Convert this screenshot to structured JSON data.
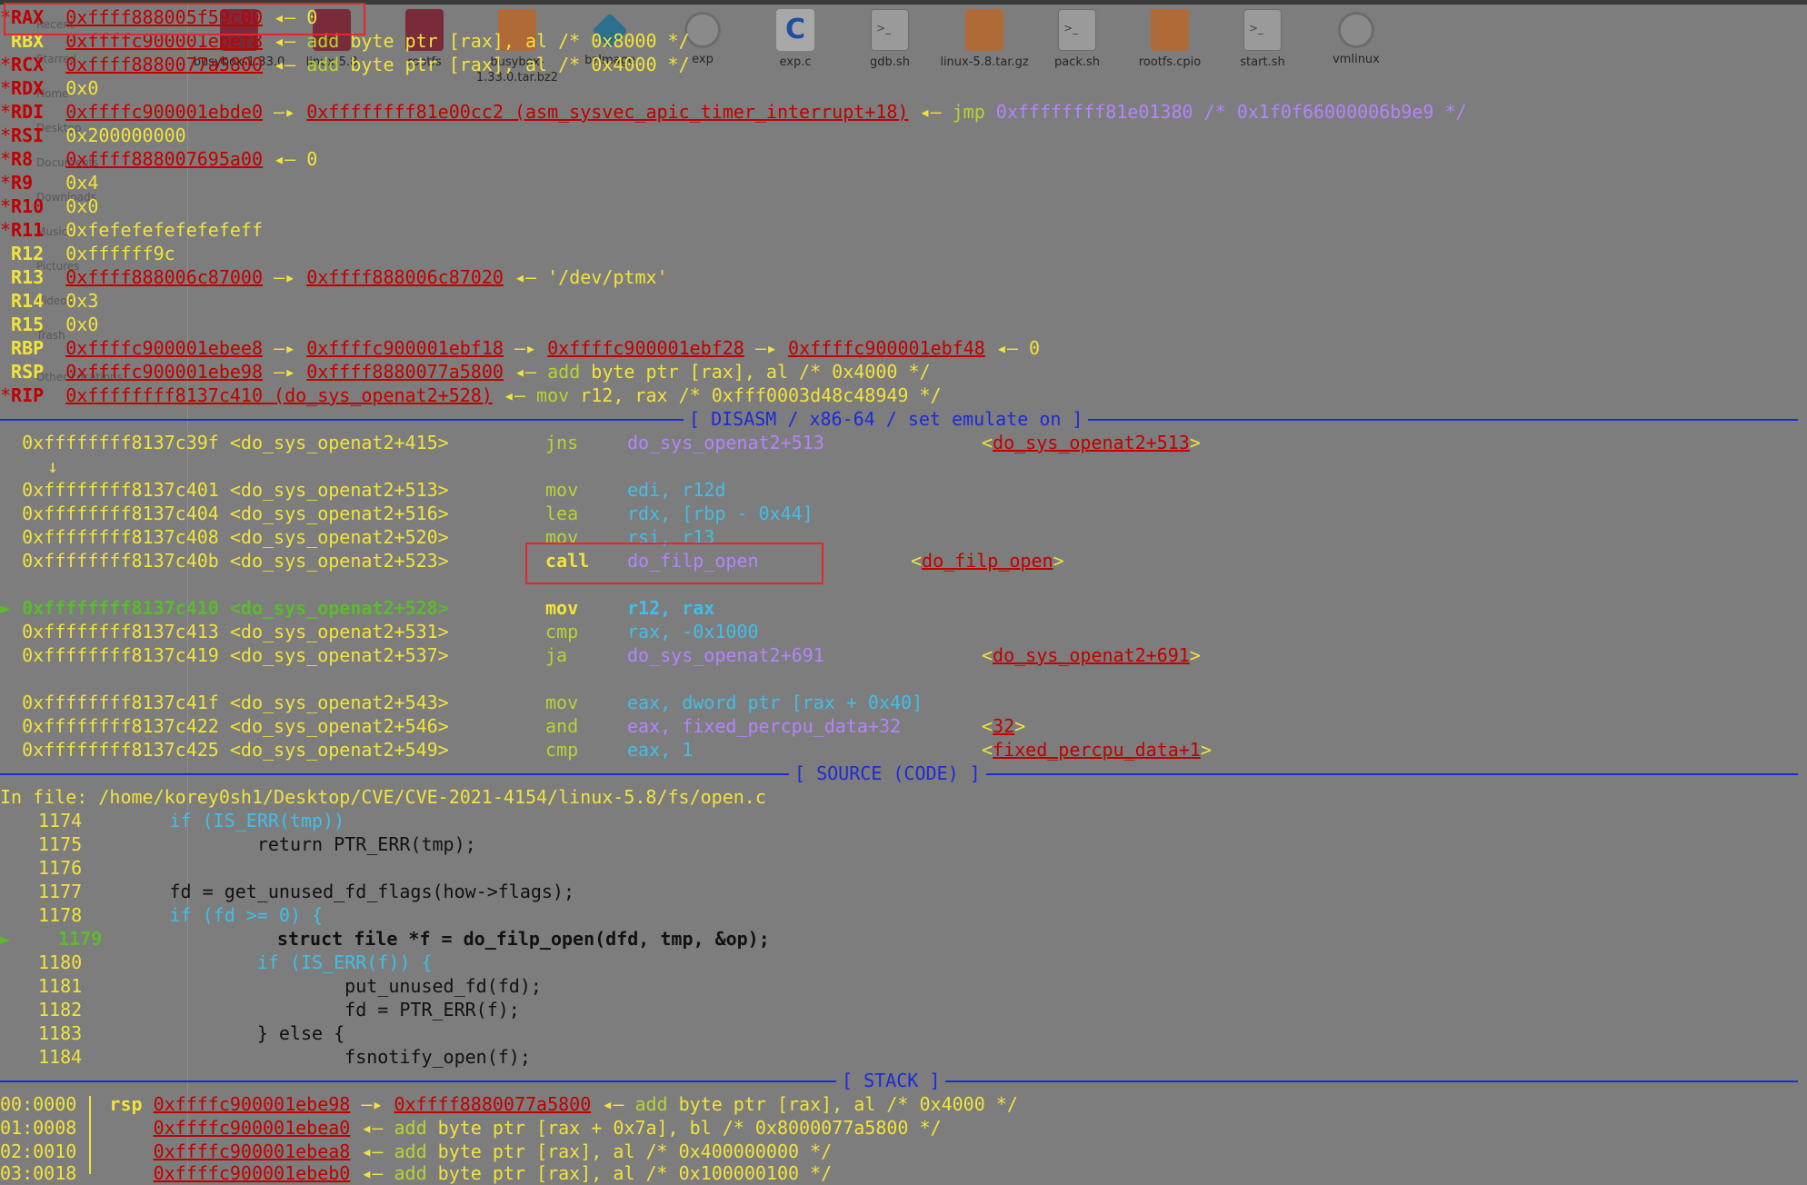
{
  "desktop": {
    "sidebar": [
      "Recent",
      "Starred",
      "Home",
      "Desktop",
      "Documents",
      "Downloads",
      "Music",
      "Pictures",
      "Videos",
      "Trash",
      "Other Locations"
    ],
    "icons": [
      {
        "label": "busybox-1.33.0",
        "kind": "folder"
      },
      {
        "label": "linux-5.8",
        "kind": "folder"
      },
      {
        "label": "rootfs",
        "kind": "folder"
      },
      {
        "label": "busybox-1.33.0.tar.bz2",
        "kind": "archive"
      },
      {
        "label": "bzImage",
        "kind": "diamond"
      },
      {
        "label": "exp",
        "kind": "gear"
      },
      {
        "label": "exp.c",
        "kind": "cfile"
      },
      {
        "label": "gdb.sh",
        "kind": "script"
      },
      {
        "label": "linux-5.8.tar.gz",
        "kind": "archive"
      },
      {
        "label": "pack.sh",
        "kind": "script"
      },
      {
        "label": "rootfs.cpio",
        "kind": "archive"
      },
      {
        "label": "start.sh",
        "kind": "script"
      },
      {
        "label": "vmlinux",
        "kind": "gear"
      }
    ]
  },
  "registers": {
    "rax": {
      "star": "*",
      "name": "RAX",
      "val": "0xffff888005f59c00",
      "arrow": " ◂— ",
      "rest": "0"
    },
    "rbx": {
      "star": " ",
      "name": "RBX",
      "val": "0xffffc900001ebef8",
      "arrow": " ◂— ",
      "ins": "add",
      "rest": " byte ptr [rax], al /* 0x8000 */"
    },
    "rcx": {
      "star": "*",
      "name": "RCX",
      "val": "0xffff8880077a5800",
      "arrow": " ◂— ",
      "ins": "add",
      "rest": " byte ptr [rax], al /* 0x4000 */"
    },
    "rdx": {
      "star": "*",
      "name": "RDX",
      "val": "0x0"
    },
    "rdi": {
      "star": "*",
      "name": "RDI",
      "val": "0xffffc900001ebde0",
      "arrow": " —▸ ",
      "val2": "0xffffffff81e00cc2 (asm_sysvec_apic_timer_interrupt+18)",
      "arrow2": " ◂— ",
      "ins": "jmp",
      "rest": " 0xffffffff81e01380 /* 0x1f0f66000006b9e9 */"
    },
    "rsi": {
      "star": "*",
      "name": "RSI",
      "val": "0x200000000"
    },
    "r8": {
      "star": "*",
      "name": "R8 ",
      "val": "0xffff888007695a00",
      "arrow": " ◂— ",
      "rest": "0"
    },
    "r9": {
      "star": "*",
      "name": "R9 ",
      "val": "0x4"
    },
    "r10": {
      "star": "*",
      "name": "R10",
      "val": "0x0"
    },
    "r11": {
      "star": "*",
      "name": "R11",
      "val": "0xfefefefefefefeff"
    },
    "r12": {
      "star": " ",
      "name": "R12",
      "val": "0xffffff9c"
    },
    "r13": {
      "star": " ",
      "name": "R13",
      "val": "0xffff888006c87000",
      "arrow": " —▸ ",
      "val2": "0xffff888006c87020",
      "arrow2": " ◂— ",
      "rest": "'/dev/ptmx'"
    },
    "r14": {
      "star": " ",
      "name": "R14",
      "val": "0x3"
    },
    "r15": {
      "star": " ",
      "name": "R15",
      "val": "0x0"
    },
    "rbp": {
      "star": " ",
      "name": "RBP",
      "val": "0xffffc900001ebee8",
      "a1": " —▸ ",
      "v2": "0xffffc900001ebf18",
      "a2": " —▸ ",
      "v3": "0xffffc900001ebf28",
      "a3": " —▸ ",
      "v4": "0xffffc900001ebf48",
      "a4": " ◂— ",
      "rest": "0"
    },
    "rsp": {
      "star": " ",
      "name": "RSP",
      "val": "0xffffc900001ebe98",
      "arrow": " —▸ ",
      "val2": "0xffff8880077a5800",
      "arrow2": " ◂— ",
      "ins": "add",
      "rest": " byte ptr [rax], al /* 0x4000 */"
    },
    "rip": {
      "star": "*",
      "name": "RIP",
      "val": "0xffffffff8137c410 (do_sys_openat2+528)",
      "arrow": " ◂— ",
      "ins": "mov",
      "rest": " r12, rax /* 0xfff0003d48c48949 */"
    }
  },
  "sections": {
    "disasm": "[ DISASM / x86-64 / set emulate on ]",
    "source": "[ SOURCE (CODE) ]",
    "stack": "[ STACK ]"
  },
  "disasm": [
    {
      "mark": "  ",
      "addr": "0xffffffff8137c39f <do_sys_openat2+415>",
      "op": "jns",
      "args": "do_sys_openat2+513",
      "target": "do_sys_openat2+513"
    },
    {
      "mark": "  ",
      "addr": "0xffffffff8137c401 <do_sys_openat2+513>",
      "op": "mov",
      "args": "edi, r12d",
      "target": ""
    },
    {
      "mark": "  ",
      "addr": "0xffffffff8137c404 <do_sys_openat2+516>",
      "op": "lea",
      "args": "rdx, [rbp - 0x44]",
      "target": ""
    },
    {
      "mark": "  ",
      "addr": "0xffffffff8137c408 <do_sys_openat2+520>",
      "op": "mov",
      "args": "rsi, r13",
      "target": ""
    },
    {
      "mark": "  ",
      "addr": "0xffffffff8137c40b <do_sys_openat2+523>",
      "op": "call",
      "args": "do_filp_open",
      "target": "do_filp_open"
    },
    {
      "mark": "► ",
      "addr": "0xffffffff8137c410 <do_sys_openat2+528>",
      "op": "mov",
      "args": "r12, rax",
      "target": ""
    },
    {
      "mark": "  ",
      "addr": "0xffffffff8137c413 <do_sys_openat2+531>",
      "op": "cmp",
      "args": "rax, -0x1000",
      "target": ""
    },
    {
      "mark": "  ",
      "addr": "0xffffffff8137c419 <do_sys_openat2+537>",
      "op": "ja",
      "args": "do_sys_openat2+691",
      "target": "do_sys_openat2+691"
    },
    {
      "mark": "  ",
      "addr": "0xffffffff8137c41f <do_sys_openat2+543>",
      "op": "mov",
      "args": "eax, dword ptr [rax + 0x40]",
      "target": ""
    },
    {
      "mark": "  ",
      "addr": "0xffffffff8137c422 <do_sys_openat2+546>",
      "op": "and",
      "args": "eax, fixed_percpu_data+32",
      "target": "32"
    },
    {
      "mark": "  ",
      "addr": "0xffffffff8137c425 <do_sys_openat2+549>",
      "op": "cmp",
      "args": "eax, 1",
      "target": "fixed_percpu_data+1"
    }
  ],
  "down_arrow": "↓",
  "source": {
    "file_label": "In file: ",
    "file_path": "/home/korey0sh1/Desktop/CVE/CVE-2021-4154/linux-5.8/fs/open.c",
    "lines": [
      {
        "no": "1174",
        "code": "        if (IS_ERR(tmp))"
      },
      {
        "no": "1175",
        "code": "                return PTR_ERR(tmp);"
      },
      {
        "no": "1176",
        "code": ""
      },
      {
        "no": "1177",
        "code": "        fd = get_unused_fd_flags(how->flags);"
      },
      {
        "no": "1178",
        "code": "        if (fd >= 0) {"
      },
      {
        "no": "1179",
        "code": "                struct file *f = do_filp_open(dfd, tmp, &op);",
        "current": true
      },
      {
        "no": "1180",
        "code": "                if (IS_ERR(f)) {"
      },
      {
        "no": "1181",
        "code": "                        put_unused_fd(fd);"
      },
      {
        "no": "1182",
        "code": "                        fd = PTR_ERR(f);"
      },
      {
        "no": "1183",
        "code": "                } else {"
      },
      {
        "no": "1184",
        "code": "                        fsnotify_open(f);"
      }
    ]
  },
  "stack": [
    {
      "off": "00:0000",
      "reg": "rsp",
      "addr": "0xffffc900001ebe98",
      "arrow": " —▸ ",
      "ptr": "0xffff8880077a5800",
      "arrow2": " ◂— ",
      "ins": "add",
      "rest": " byte ptr [rax], al /* 0x4000 */"
    },
    {
      "off": "01:0008",
      "reg": "",
      "addr": "0xffffc900001ebea0",
      "arrow": " ◂— ",
      "ins": "add",
      "rest": " byte ptr [rax + 0x7a], bl /* 0x8000077a5800 */"
    },
    {
      "off": "02:0010",
      "reg": "",
      "addr": "0xffffc900001ebea8",
      "arrow": " ◂— ",
      "ins": "add",
      "rest": " byte ptr [rax], al /* 0x400000000 */"
    },
    {
      "off": "03:0018",
      "reg": "",
      "addr": "0xffffc900001ebeb0",
      "arrow": " ◂— ",
      "ins": "add",
      "rest": " byte ptr [rax], al /* 0x100000100 */"
    }
  ]
}
